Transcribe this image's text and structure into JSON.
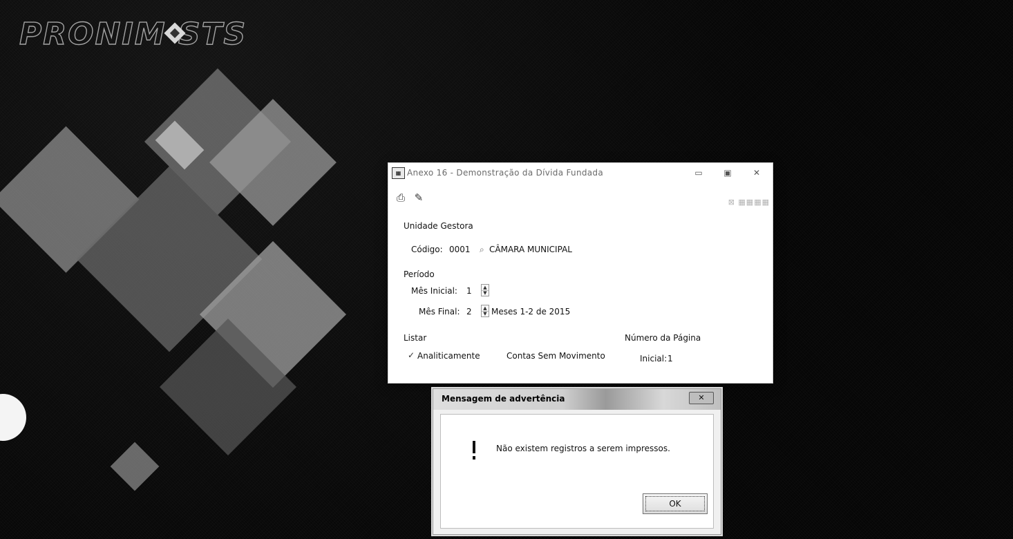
{
  "desktop": {
    "logo_text": "PRONIM STS"
  },
  "dialog": {
    "title": "Anexo 16 - Demonstração da Dívida Fundada",
    "toolbar": {
      "print_icon": "printer-icon",
      "edit_icon": "pencil-icon"
    },
    "unidade_gestora": {
      "section_label": "Unidade Gestora",
      "codigo_label": "Código:",
      "codigo_value": "0001",
      "name": "CÂMARA MUNICIPAL"
    },
    "periodo": {
      "section_label": "Período",
      "mes_inicial_label": "Mês Inicial:",
      "mes_inicial_value": "1",
      "mes_final_label": "Mês Final:",
      "mes_final_value": "2",
      "summary": "Meses 1-2 de 2015"
    },
    "listar": {
      "section_label": "Listar",
      "analiticamente_label": "Analiticamente",
      "analiticamente_checked": true,
      "contas_label": "Contas Sem Movimento",
      "contas_checked": false
    },
    "pagina": {
      "section_label": "Número da Página",
      "inicial_label": "Inicial:",
      "inicial_value": "1"
    }
  },
  "message": {
    "title": "Mensagem de advertência",
    "text": "Não existem registros a serem impressos.",
    "ok_label": "OK",
    "icon": "warning-icon"
  }
}
